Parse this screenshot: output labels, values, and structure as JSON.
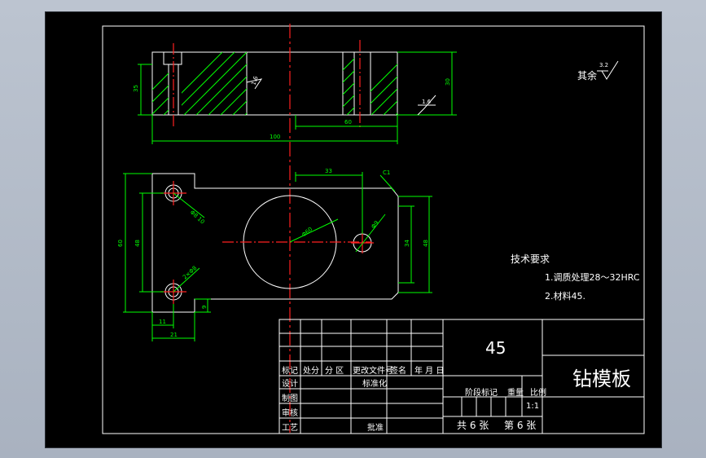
{
  "drawing": {
    "surface_note": "其余",
    "surface_roughness_default": "3.2",
    "roughness_marks": [
      "1.6",
      "3.2"
    ],
    "dimensions": {
      "front_height_left": "35",
      "front_height_right": "30",
      "front_width_total": "100",
      "front_inner": "60",
      "plan_hole_spacing": "33",
      "plan_chamfer": "C1",
      "plan_height_total": "60",
      "plan_height_inner": "48",
      "plan_height_right_outer": "48",
      "plan_height_right_inner": "34",
      "plan_circle_dia": "Φ60",
      "plan_small_hole_dia": "Φ9",
      "plan_hole_top_label": "Φ8 10",
      "plan_hole_bottom_label": "2×Φ8",
      "plan_bottom_11": "11",
      "plan_bottom_21": "21",
      "plan_right_small": "9"
    },
    "tech_requirements": {
      "title": "技术要求",
      "items": [
        "1.调质处理28～32HRC",
        "2.材料45."
      ]
    }
  },
  "title_block": {
    "material": "45",
    "part_name": "钻模板",
    "row_headers": [
      "标记",
      "处分",
      "分 区",
      "更改文件号",
      "签名",
      "年 月 日"
    ],
    "roles": [
      "设计",
      "制图",
      "审核",
      "工艺"
    ],
    "standardization": "标准化",
    "approve": "批准",
    "stage_mark": "阶段标记",
    "weight": "重量",
    "scale": "比例",
    "scale_value": "1:1",
    "sheet_total": "共 6 张",
    "sheet_no": "第 6 张"
  }
}
